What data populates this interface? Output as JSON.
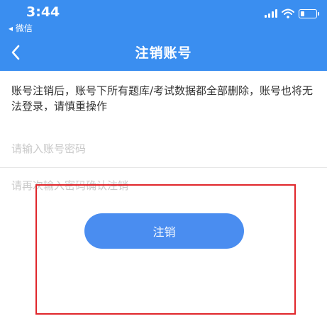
{
  "status_bar": {
    "time": "3:44",
    "back_app_label": "◂ 微信"
  },
  "nav": {
    "title": "注销账号",
    "back_icon": "chevron-left-icon"
  },
  "notice": "账号注销后，账号下所有题库/考试数据都全部删除，账号也将无法登录，请慎重操作",
  "form": {
    "password_placeholder": "请输入账号密码",
    "confirm_placeholder": "请再次输入密码确认注销",
    "submit_label": "注销"
  },
  "colors": {
    "primary": "#3a8ef0",
    "button": "#4a8df0",
    "annotation": "#e0262b"
  }
}
